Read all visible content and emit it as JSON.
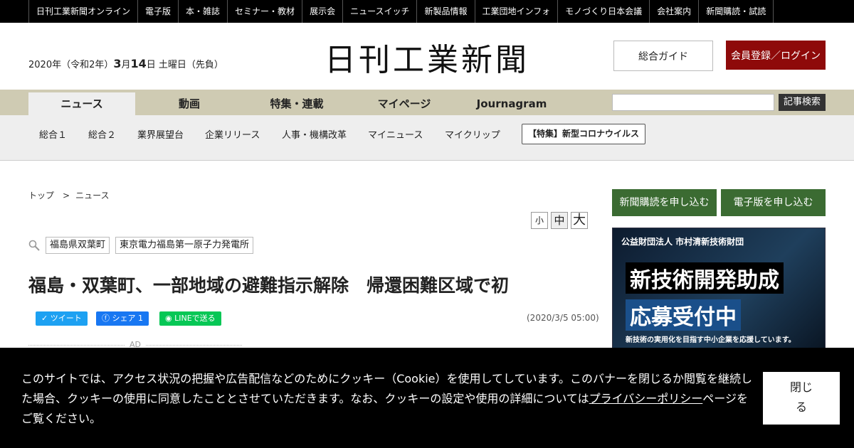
{
  "topbar": [
    "日刊工業新聞オンライン",
    "電子版",
    "本・雑誌",
    "セミナー・教材",
    "展示会",
    "ニュースイッチ",
    "新製品情報",
    "工業団地インフォ",
    "モノづくり日本会議",
    "会社案内",
    "新聞購読・試読"
  ],
  "header": {
    "date_prefix": "2020年（令和2年）",
    "month": "3",
    "month_unit": "月",
    "day": "14",
    "day_suffix": "日 土曜日（先負）",
    "logo": "日刊工業新聞",
    "guide_label": "総合ガイド",
    "login_label": "会員登録／ログイン"
  },
  "nav": {
    "tabs": [
      "ニュース",
      "動画",
      "特集・連載",
      "マイページ",
      "Journagram"
    ],
    "search_placeholder": "",
    "search_label": "記事検索"
  },
  "subnav": {
    "items": [
      "総合１",
      "総合２",
      "業界展望台",
      "企業リリース",
      "人事・機構改革",
      "マイニュース",
      "マイクリップ"
    ],
    "special": "【特集】新型コロナウイルス"
  },
  "article": {
    "breadcrumb": [
      "トップ",
      "ニュース"
    ],
    "breadcrumb_sep": ">",
    "font_sizes": [
      "小",
      "中",
      "大"
    ],
    "tags": [
      "福島県双葉町",
      "東京電力福島第一原子力発電所"
    ],
    "title": "福島・双葉町、一部地域の避難指示解除　帰還困難区域で初",
    "share": {
      "tweet": "ツイート",
      "facebook": "シェア 1",
      "line": "LINEで送る"
    },
    "date": "(2020/3/5 05:00)",
    "ad": "AD"
  },
  "sidebar": {
    "subscribe_paper": "新聞購読を申し込む",
    "subscribe_digital": "電子版を申し込む",
    "banner": {
      "org": "公益財団法人 市村清新技術財団",
      "line1": "新技術開発助成",
      "line2": "応募受付中",
      "line3": "新技術の実用化を目指す中小企業を応援しています。"
    }
  },
  "cookie": {
    "text_before": "このサイトでは、アクセス状況の把握や広告配信などのためにクッキー（Cookie）を使用してしています。このバナーを閉じるか閲覧を継続した場合、クッキーの使用に同意したこととさせていただきます。なお、クッキーの設定や使用の詳細については",
    "link": "プライバシーポリシー",
    "text_after": "ページをご覧ください。",
    "close_line1": "閉じ",
    "close_line2": "る"
  }
}
